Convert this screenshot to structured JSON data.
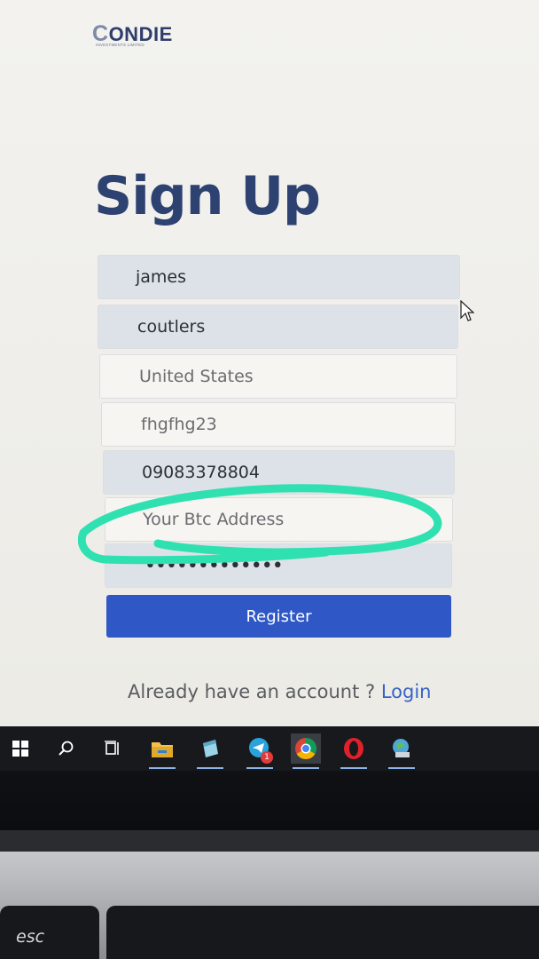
{
  "brand": {
    "name_first_letter": "C",
    "name_rest": "ONDIE",
    "tagline": "INVESTMENTS LIMITED"
  },
  "page_title": "Sign Up",
  "form": {
    "fields": [
      {
        "value": "james",
        "state": "filled"
      },
      {
        "value": "coutlers",
        "state": "filled"
      },
      {
        "value": "United States",
        "state": "filled"
      },
      {
        "value": "fhgfhg23",
        "state": "filled"
      },
      {
        "value": "09083378804",
        "state": "filled"
      },
      {
        "placeholder": "Your Btc Address",
        "value": "",
        "state": "empty"
      },
      {
        "value": "•••••••••••••",
        "type": "password",
        "state": "filled"
      }
    ],
    "submit_label": "Register",
    "login_prompt": "Already have an account ?",
    "login_link": "Login"
  },
  "colors": {
    "title": "#2e4271",
    "button": "#2f58c6",
    "link": "#3563c9",
    "highlight_scribble": "#2fe0b0"
  },
  "taskbar": {
    "icons": [
      "windows-start-icon",
      "search-icon",
      "task-view-icon",
      "file-explorer-icon",
      "notepad-icon",
      "telegram-icon",
      "chrome-icon",
      "opera-icon",
      "network-globe-icon"
    ],
    "telegram_badge": "1"
  },
  "keyboard": {
    "esc_label": "esc"
  }
}
